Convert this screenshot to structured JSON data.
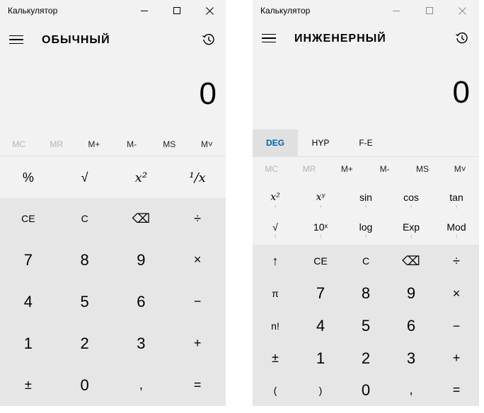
{
  "standard": {
    "window_title": "Калькулятор",
    "mode_title": "ОБЫЧНЫЙ",
    "display": "0",
    "memory": [
      {
        "label": "MC",
        "disabled": true
      },
      {
        "label": "MR",
        "disabled": true
      },
      {
        "label": "M+",
        "disabled": false
      },
      {
        "label": "M-",
        "disabled": false
      },
      {
        "label": "MS",
        "disabled": false
      },
      {
        "label": "M˅",
        "disabled": false
      }
    ],
    "keys": [
      [
        "%",
        "√",
        "x²",
        "¹/x"
      ],
      [
        "CE",
        "C",
        "⌫",
        "÷"
      ],
      [
        "7",
        "8",
        "9",
        "×"
      ],
      [
        "4",
        "5",
        "6",
        "−"
      ],
      [
        "1",
        "2",
        "3",
        "+"
      ],
      [
        "±",
        "0",
        ",",
        "="
      ]
    ]
  },
  "engineering": {
    "window_title": "Калькулятор",
    "mode_title": "ИНЖЕНЕРНЫЙ",
    "display": "0",
    "angle_buttons": [
      "DEG",
      "HYP",
      "F-E"
    ],
    "memory": [
      {
        "label": "MC",
        "disabled": true
      },
      {
        "label": "MR",
        "disabled": true
      },
      {
        "label": "M+",
        "disabled": false
      },
      {
        "label": "M-",
        "disabled": false
      },
      {
        "label": "MS",
        "disabled": false
      },
      {
        "label": "M˅",
        "disabled": false
      }
    ],
    "sci_row1": [
      "x²",
      "xʸ",
      "sin",
      "cos",
      "tan"
    ],
    "sci_row2": [
      "√",
      "10ˣ",
      "log",
      "Exp",
      "Mod"
    ],
    "keys": [
      [
        "↑",
        "CE",
        "C",
        "⌫",
        "÷"
      ],
      [
        "π",
        "7",
        "8",
        "9",
        "×"
      ],
      [
        "n!",
        "4",
        "5",
        "6",
        "−"
      ],
      [
        "±",
        "1",
        "2",
        "3",
        "+"
      ],
      [
        "(",
        ")",
        "0",
        ",",
        "="
      ]
    ],
    "arrow_glyph": "↑"
  }
}
